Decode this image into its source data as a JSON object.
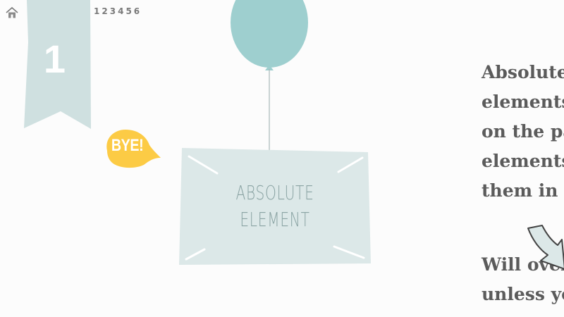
{
  "nav": {
    "home_icon": "home-icon",
    "pages": [
      "1",
      "2",
      "3",
      "4",
      "5",
      "6"
    ]
  },
  "ribbon": {
    "number": "1"
  },
  "bubble": {
    "text": "BYE!"
  },
  "card": {
    "line1": "ABSOLUTE",
    "line2": "ELEMENT"
  },
  "description": {
    "paragraph1": [
      "Absolute",
      "elements",
      "on the pa",
      "elements",
      "them in t"
    ],
    "paragraph2": [
      "Will over",
      "unless yo"
    ]
  },
  "colors": {
    "ribbon": "#cfe0e0",
    "balloon": "#9ecfcf",
    "card": "#dce8e8",
    "bubble": "#fccb45",
    "text": "#5b5b5b",
    "card_text": "#8aa3a3"
  },
  "icons": {
    "arrow": "curved-arrow-icon"
  }
}
